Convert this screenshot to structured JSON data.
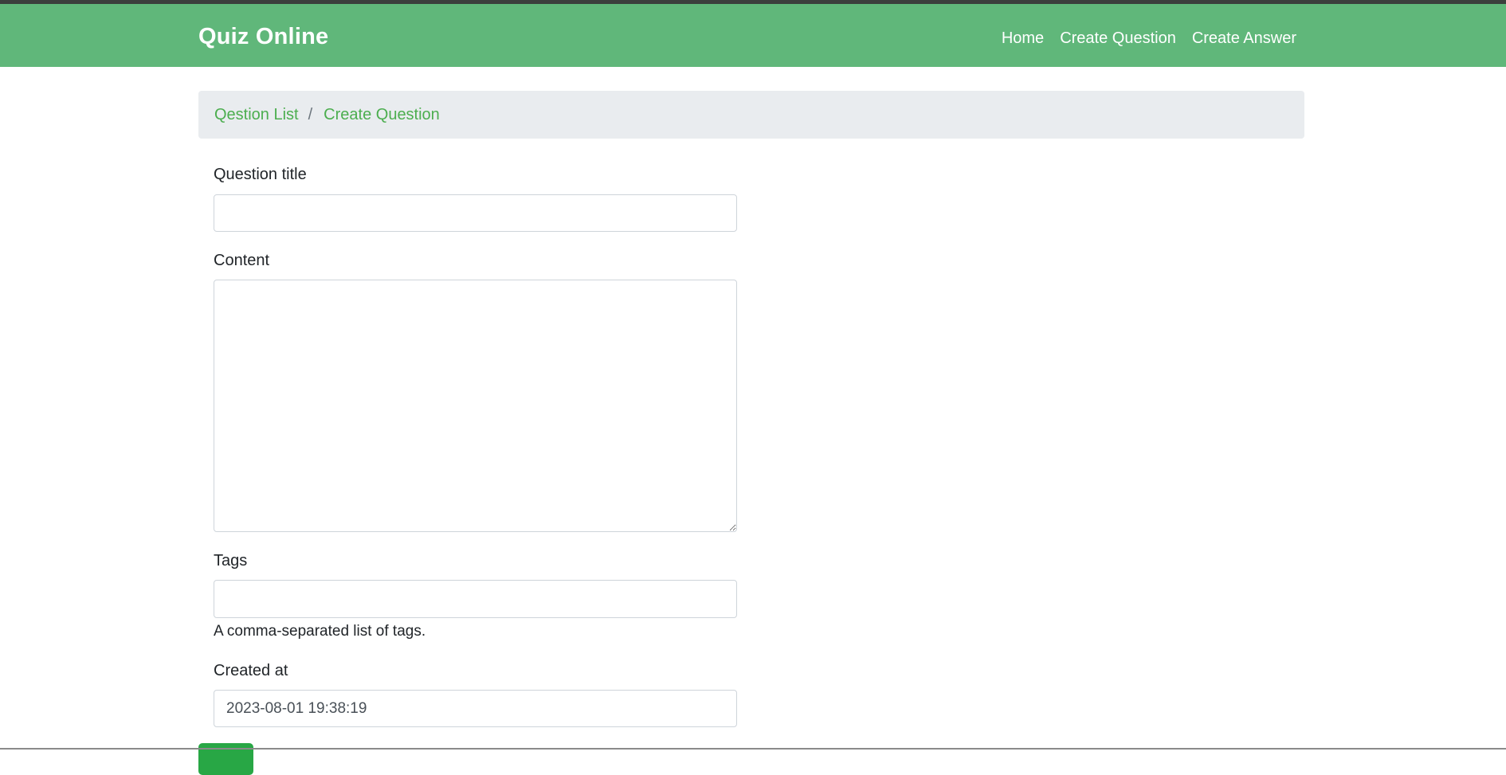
{
  "navbar": {
    "brand": "Quiz Online",
    "links": [
      "Home",
      "Create Question",
      "Create Answer"
    ],
    "color": "#60b77a"
  },
  "breadcrumb": {
    "items": [
      "Qestion List",
      "Create Question"
    ],
    "separator": "/"
  },
  "form": {
    "title": {
      "label": "Question title",
      "value": ""
    },
    "content": {
      "label": "Content",
      "value": ""
    },
    "tags": {
      "label": "Tags",
      "value": "",
      "help": "A comma-separated list of tags."
    },
    "created_at": {
      "label": "Created at",
      "value": "2023-08-01 19:38:19"
    }
  },
  "submit_color": "#28a745"
}
